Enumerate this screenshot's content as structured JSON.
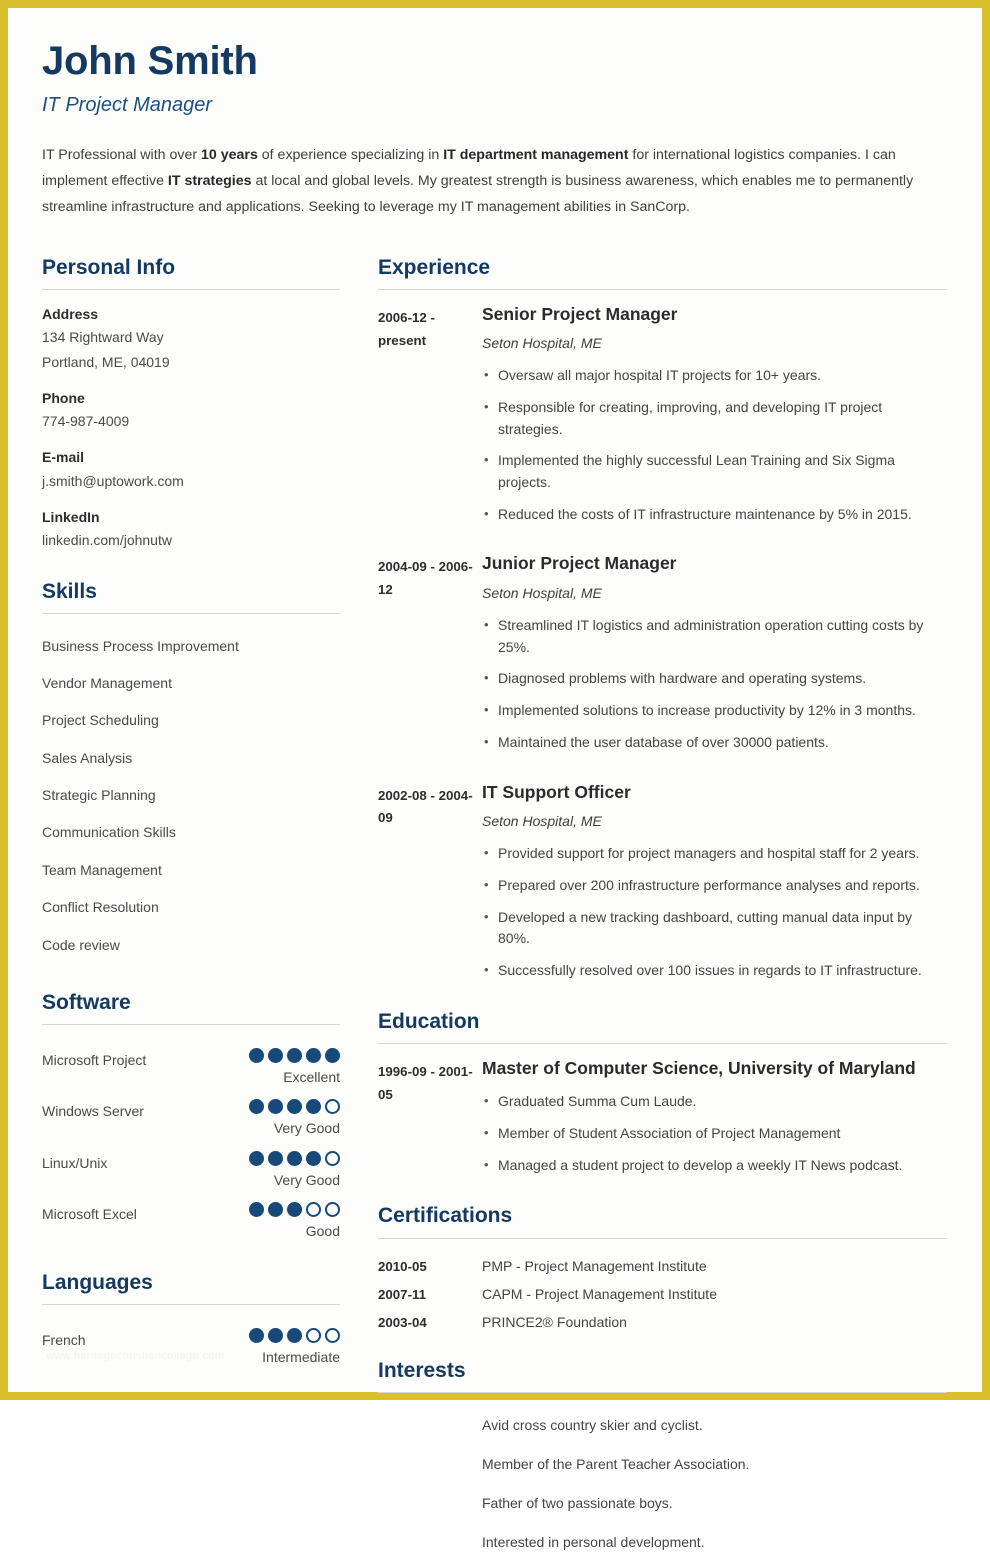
{
  "theme": {
    "frame_color": "#d9bf2b",
    "heading_color": "#143a62",
    "accent_color": "#17497a",
    "body_text_color": "#444444",
    "page_background": "#fdfdfc"
  },
  "header": {
    "name": "John Smith",
    "role": "IT Project Manager",
    "summary_parts": [
      {
        "text": "IT Professional with over ",
        "bold": false
      },
      {
        "text": "10 years",
        "bold": true
      },
      {
        "text": " of experience specializing in ",
        "bold": false
      },
      {
        "text": "IT department management",
        "bold": true
      },
      {
        "text": " for international logistics companies. I can implement effective ",
        "bold": false
      },
      {
        "text": "IT strategies",
        "bold": true
      },
      {
        "text": " at local and global levels. My greatest strength is business awareness, which enables me to permanently streamline infrastructure and applications. Seeking to leverage my IT management abilities in SanCorp.",
        "bold": false
      }
    ]
  },
  "personal_info": {
    "title": "Personal Info",
    "fields": [
      {
        "label": "Address",
        "values": [
          "134 Rightward Way",
          "Portland, ME, 04019"
        ]
      },
      {
        "label": "Phone",
        "values": [
          "774-987-4009"
        ]
      },
      {
        "label": "E-mail",
        "values": [
          "j.smith@uptowork.com"
        ]
      },
      {
        "label": "LinkedIn",
        "values": [
          "linkedin.com/johnutw"
        ]
      }
    ]
  },
  "skills": {
    "title": "Skills",
    "items": [
      "Business Process Improvement",
      "Vendor Management",
      "Project Scheduling",
      "Sales Analysis",
      "Strategic Planning",
      "Communication Skills",
      "Team Management",
      "Conflict Resolution",
      "Code review"
    ]
  },
  "software": {
    "title": "Software",
    "max_rating": 5,
    "items": [
      {
        "name": "Microsoft Project",
        "rating": 5,
        "label": "Excellent"
      },
      {
        "name": "Windows Server",
        "rating": 4,
        "label": "Very Good"
      },
      {
        "name": "Linux/Unix",
        "rating": 4,
        "label": "Very Good"
      },
      {
        "name": "Microsoft Excel",
        "rating": 3,
        "label": "Good"
      }
    ]
  },
  "languages": {
    "title": "Languages",
    "max_rating": 5,
    "items": [
      {
        "name": "French",
        "rating": 3,
        "label": "Intermediate"
      }
    ]
  },
  "experience": {
    "title": "Experience",
    "entries": [
      {
        "date": "2006-12 - present",
        "job_title": "Senior Project Manager",
        "employer": "Seton Hospital, ME",
        "bullets": [
          "Oversaw all major hospital IT projects for 10+ years.",
          "Responsible for creating, improving, and developing IT project strategies.",
          "Implemented the highly successful Lean Training and Six Sigma projects.",
          "Reduced the costs of IT infrastructure maintenance by 5% in 2015."
        ]
      },
      {
        "date": "2004-09 - 2006-12",
        "job_title": "Junior Project Manager",
        "employer": "Seton Hospital, ME",
        "bullets": [
          "Streamlined IT logistics and administration operation cutting costs by 25%.",
          "Diagnosed problems with hardware and operating systems.",
          "Implemented solutions to increase productivity by 12% in 3 months.",
          "Maintained the user database of over 30000 patients."
        ]
      },
      {
        "date": "2002-08 - 2004-09",
        "job_title": "IT Support Officer",
        "employer": "Seton Hospital, ME",
        "bullets": [
          "Provided support for project managers and hospital staff for 2 years.",
          "Prepared over 200 infrastructure performance analyses and reports.",
          "Developed a new tracking dashboard, cutting manual data input by 80%.",
          "Successfully resolved over 100 issues in regards to IT infrastructure."
        ]
      }
    ]
  },
  "education": {
    "title": "Education",
    "entries": [
      {
        "date": "1996-09 - 2001-05",
        "degree": "Master of Computer Science, University of Maryland",
        "bullets": [
          "Graduated Summa Cum Laude.",
          "Member of Student Association of Project Management",
          "Managed a student project to develop a weekly IT News podcast."
        ]
      }
    ]
  },
  "certifications": {
    "title": "Certifications",
    "rows": [
      {
        "date": "2010-05",
        "text": "PMP - Project Management Institute"
      },
      {
        "date": "2007-11",
        "text": "CAPM - Project Management Institute"
      },
      {
        "date": "2003-04",
        "text": "PRINCE2® Foundation"
      }
    ]
  },
  "interests": {
    "title": "Interests",
    "items": [
      "Avid cross country skier and cyclist.",
      "Member of the Parent Teacher Association.",
      "Father of two passionate boys.",
      "Interested in personal development."
    ]
  },
  "watermark": {
    "text": "www.heritagechristiancollege.com"
  }
}
